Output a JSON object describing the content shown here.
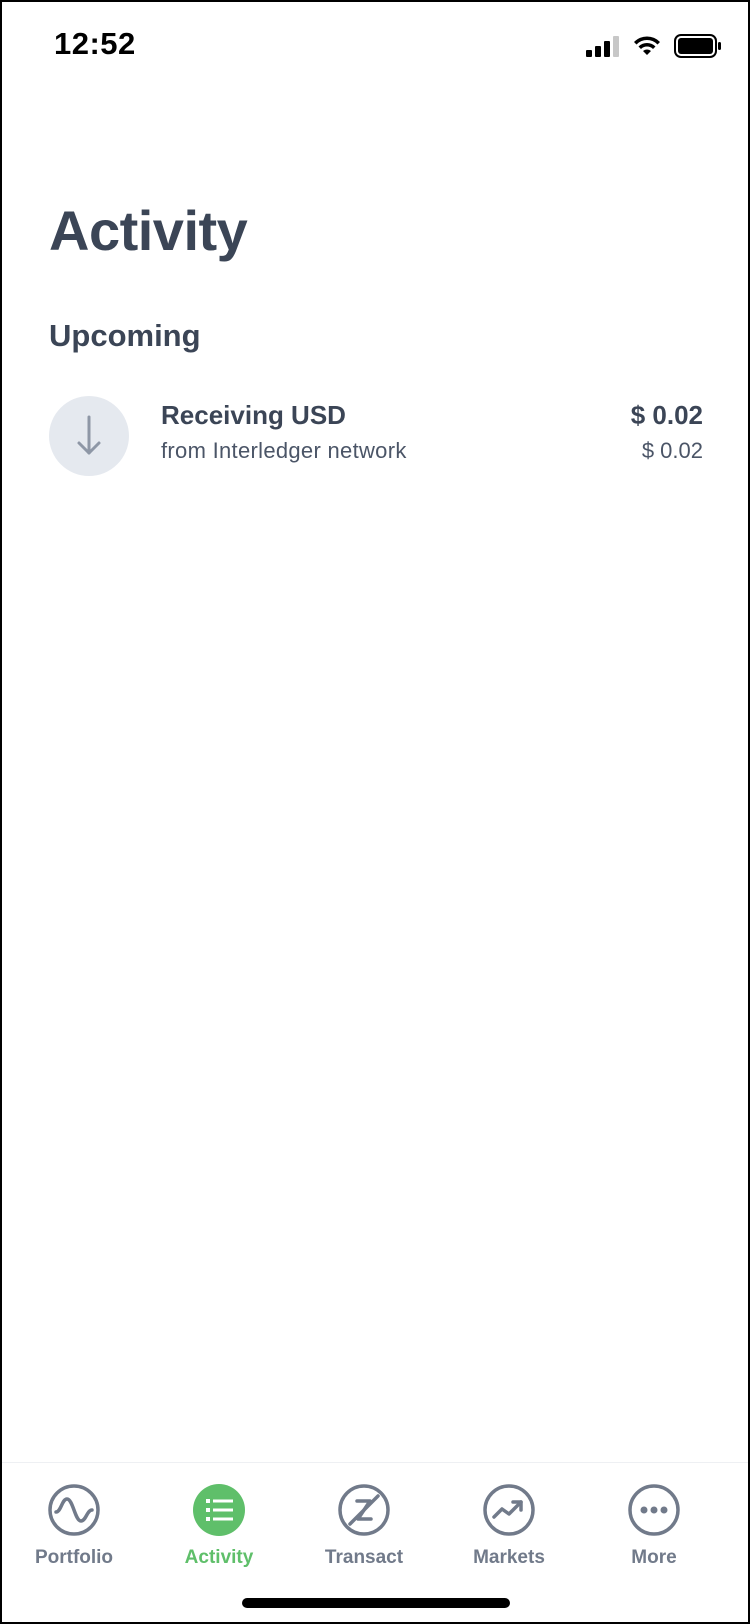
{
  "status_bar": {
    "time": "12:52"
  },
  "header": {
    "title": "Activity"
  },
  "section": {
    "title": "Upcoming"
  },
  "activity": [
    {
      "icon": "arrow-down-icon",
      "title": "Receiving USD",
      "subtitle": "from Interledger network",
      "amount": "$ 0.02",
      "amount_secondary": "$ 0.02"
    }
  ],
  "tabs": [
    {
      "label": "Portfolio",
      "icon": "portfolio-wave-icon",
      "active": false
    },
    {
      "label": "Activity",
      "icon": "activity-list-icon",
      "active": true
    },
    {
      "label": "Transact",
      "icon": "transact-icon",
      "active": false
    },
    {
      "label": "Markets",
      "icon": "markets-trend-icon",
      "active": false
    },
    {
      "label": "More",
      "icon": "more-dots-icon",
      "active": false
    }
  ],
  "colors": {
    "text_primary": "#3b4556",
    "tab_inactive": "#717a8a",
    "tab_active": "#5fbf6a",
    "icon_circle": "#e5e9ef"
  }
}
